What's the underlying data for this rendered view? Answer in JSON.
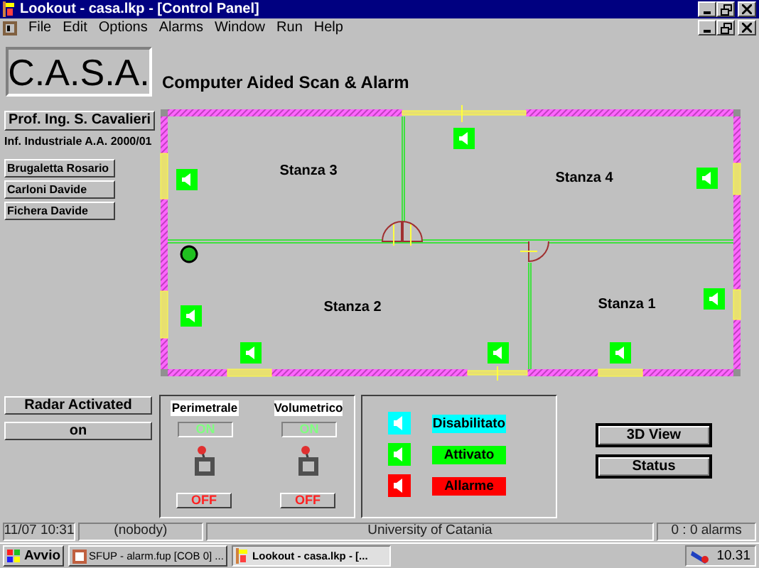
{
  "window": {
    "title": "Lookout - casa.lkp - [Control Panel]"
  },
  "menu": [
    "File",
    "Edit",
    "Options",
    "Alarms",
    "Window",
    "Run",
    "Help"
  ],
  "logo": "C.A.S.A.",
  "subtitle": "Computer Aided Scan & Alarm",
  "author": "Prof. Ing. S. Cavalieri",
  "course": "Inf. Industriale A.A. 2000/01",
  "students": [
    "Brugaletta Rosario",
    "Carloni Davide",
    "Fichera Davide"
  ],
  "rooms": [
    {
      "label": "Stanza 3"
    },
    {
      "label": "Stanza 4"
    },
    {
      "label": "Stanza 2"
    },
    {
      "label": "Stanza 1"
    }
  ],
  "sensors": [
    {
      "active": true
    },
    {
      "active": true
    },
    {
      "active": true
    },
    {
      "active": true
    },
    {
      "active": true
    },
    {
      "active": true
    },
    {
      "active": true
    },
    {
      "active": true
    }
  ],
  "radar": {
    "label": "Radar Activated",
    "value": "on"
  },
  "switches": [
    {
      "label": "Perimetrale",
      "on_label": "ON",
      "off_label": "OFF",
      "on": true
    },
    {
      "label": "Volumetrico",
      "on_label": "ON",
      "off_label": "OFF",
      "on": true
    }
  ],
  "legend": [
    {
      "color": "#00ffff",
      "label": "Disabilitato"
    },
    {
      "color": "#00ff00",
      "label": "Attivato"
    },
    {
      "color": "#ff0000",
      "label": "Allarme"
    }
  ],
  "buttons": [
    "3D View",
    "Status"
  ],
  "status_bar": [
    "11/07 10:31",
    "(nobody)",
    "University of Catania",
    "0 : 0 alarms"
  ],
  "taskbar": {
    "start": "Avvio",
    "tasks": [
      {
        "label": "SFUP - alarm.fup [COB 0] ...",
        "selected": false
      },
      {
        "label": "Lookout - casa.lkp - [...",
        "selected": true
      }
    ],
    "clock": "10.31"
  }
}
